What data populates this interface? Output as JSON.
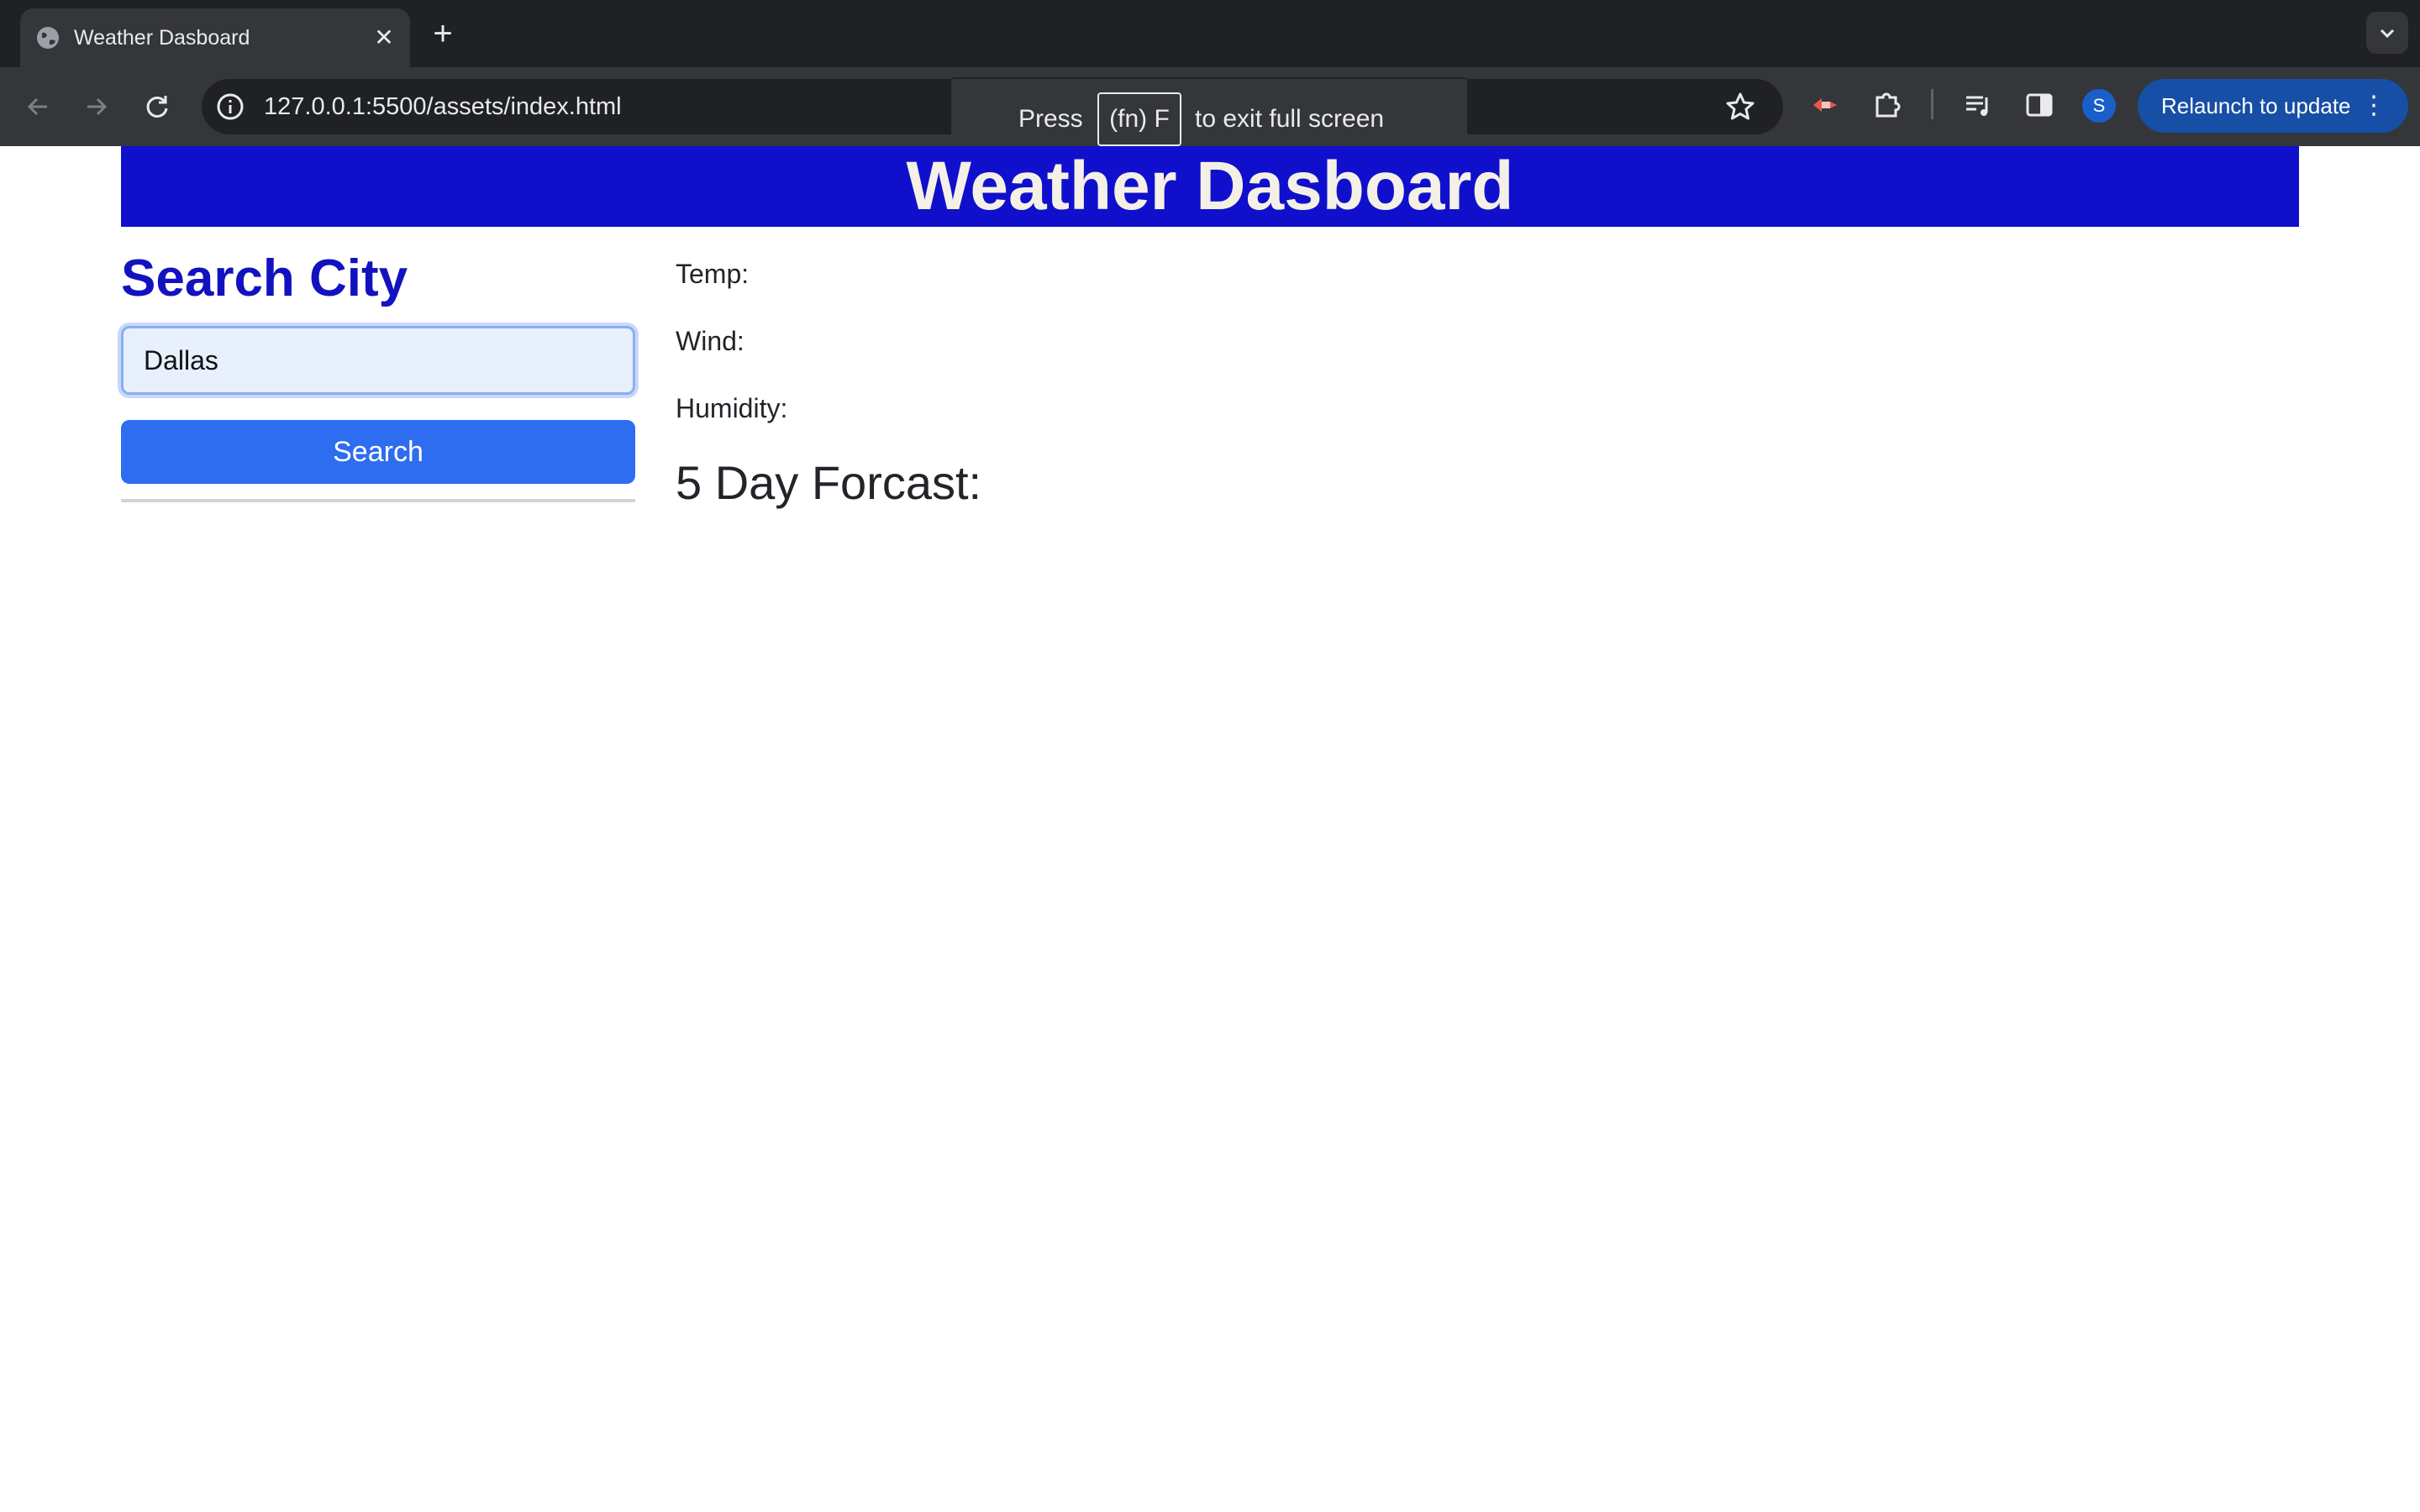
{
  "browser": {
    "tab_title": "Weather Dasboard",
    "url": "127.0.0.1:5500/assets/index.html",
    "relaunch_label": "Relaunch to update",
    "profile_initial": "S",
    "icons": [
      "globe-icon",
      "close-icon",
      "plus-icon",
      "back-icon",
      "forward-icon",
      "reload-icon",
      "info-icon",
      "star-icon",
      "extension-icon",
      "puzzle-icon",
      "media-icon",
      "side-panel-icon",
      "more-vert-icon"
    ]
  },
  "fullscreen_toast": {
    "prefix": "Press",
    "key": "(fn) F",
    "suffix": "to exit full screen"
  },
  "page": {
    "title": "Weather Dasboard",
    "search_heading": "Search City",
    "city_input_value": "Dallas",
    "search_button": "Search",
    "temp_label": "Temp:",
    "wind_label": "Wind:",
    "humidity_label": "Humidity:",
    "forecast_heading": "5 Day Forcast:",
    "colors": {
      "header_bg": "#1010cc",
      "heading": "#1212c0",
      "button": "#2e6cf0"
    }
  }
}
